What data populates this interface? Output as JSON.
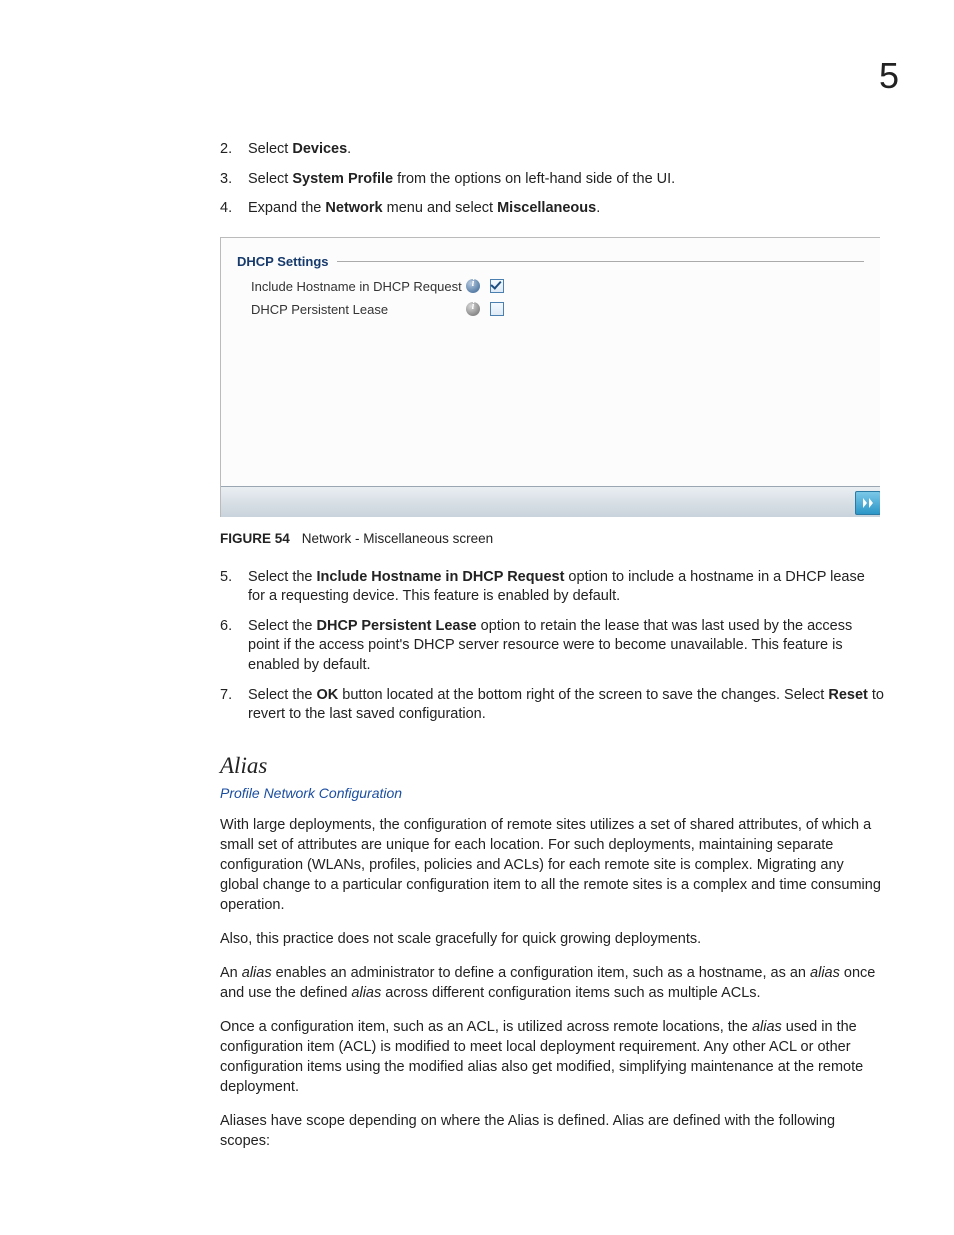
{
  "chapter_number": "5",
  "steps_top": [
    {
      "n": "2.",
      "pre": "Select ",
      "b1": "Devices",
      "post1": "."
    },
    {
      "n": "3.",
      "pre": "Select ",
      "b1": "System Profile",
      "post1": " from the options on left-hand side of the UI."
    },
    {
      "n": "4.",
      "pre": "Expand the ",
      "b1": "Network",
      "mid1": " menu and select ",
      "b2": "Miscellaneous",
      "post1": "."
    }
  ],
  "figure": {
    "legend": "DHCP Settings",
    "row1_label": "Include Hostname in DHCP Request",
    "row2_label": "DHCP Persistent Lease",
    "caption_label": "FIGURE 54",
    "caption_text": "Network - Miscellaneous screen"
  },
  "steps_bottom": [
    {
      "n": "5.",
      "pre": "Select the ",
      "b1": "Include Hostname in DHCP Request",
      "post1": " option to include a hostname in a DHCP lease for a requesting device. This feature is enabled by default."
    },
    {
      "n": "6.",
      "pre": "Select the ",
      "b1": "DHCP Persistent Lease",
      "post1": " option to retain the lease that was last used by the access point if the access point's DHCP server resource were to become unavailable. This feature is enabled by default."
    },
    {
      "n": "7.",
      "pre": "Select the ",
      "b1": "OK",
      "mid1": " button located at the bottom right of the screen to save the changes. Select ",
      "b2": "Reset",
      "post1": " to revert to the last saved configuration."
    }
  ],
  "section_heading": "Alias",
  "section_sublink": "Profile Network Configuration",
  "paras": [
    {
      "plain": "With large deployments, the configuration of remote sites utilizes a set of shared attributes, of which a small set of attributes are unique for each location. For such deployments, maintaining separate configuration (WLANs, profiles, policies and ACLs) for each remote site is complex. Migrating any global change to a particular configuration item to all the remote sites is a complex and time consuming operation."
    },
    {
      "plain": "Also, this practice does not scale gracefully for quick growing deployments."
    }
  ],
  "para_alias_intro": {
    "t0": "An ",
    "i1": "alias",
    "t1": " enables an administrator to define a configuration item, such as a hostname, as an ",
    "i2": "alias",
    "t2": " once and use the defined ",
    "i3": "alias",
    "t3": " across different configuration items such as multiple ACLs."
  },
  "para_alias_once": {
    "t0": "Once a configuration item, such as an ACL, is utilized across remote locations, the ",
    "i1": "alias",
    "t1": " used in the configuration item (ACL) is modified to meet local deployment requirement. Any other ACL or other configuration items using the modified alias also get modified, simplifying maintenance at the remote deployment."
  },
  "para_scope": "Aliases have scope depending on where the Alias is defined. Alias are defined with the following scopes:"
}
